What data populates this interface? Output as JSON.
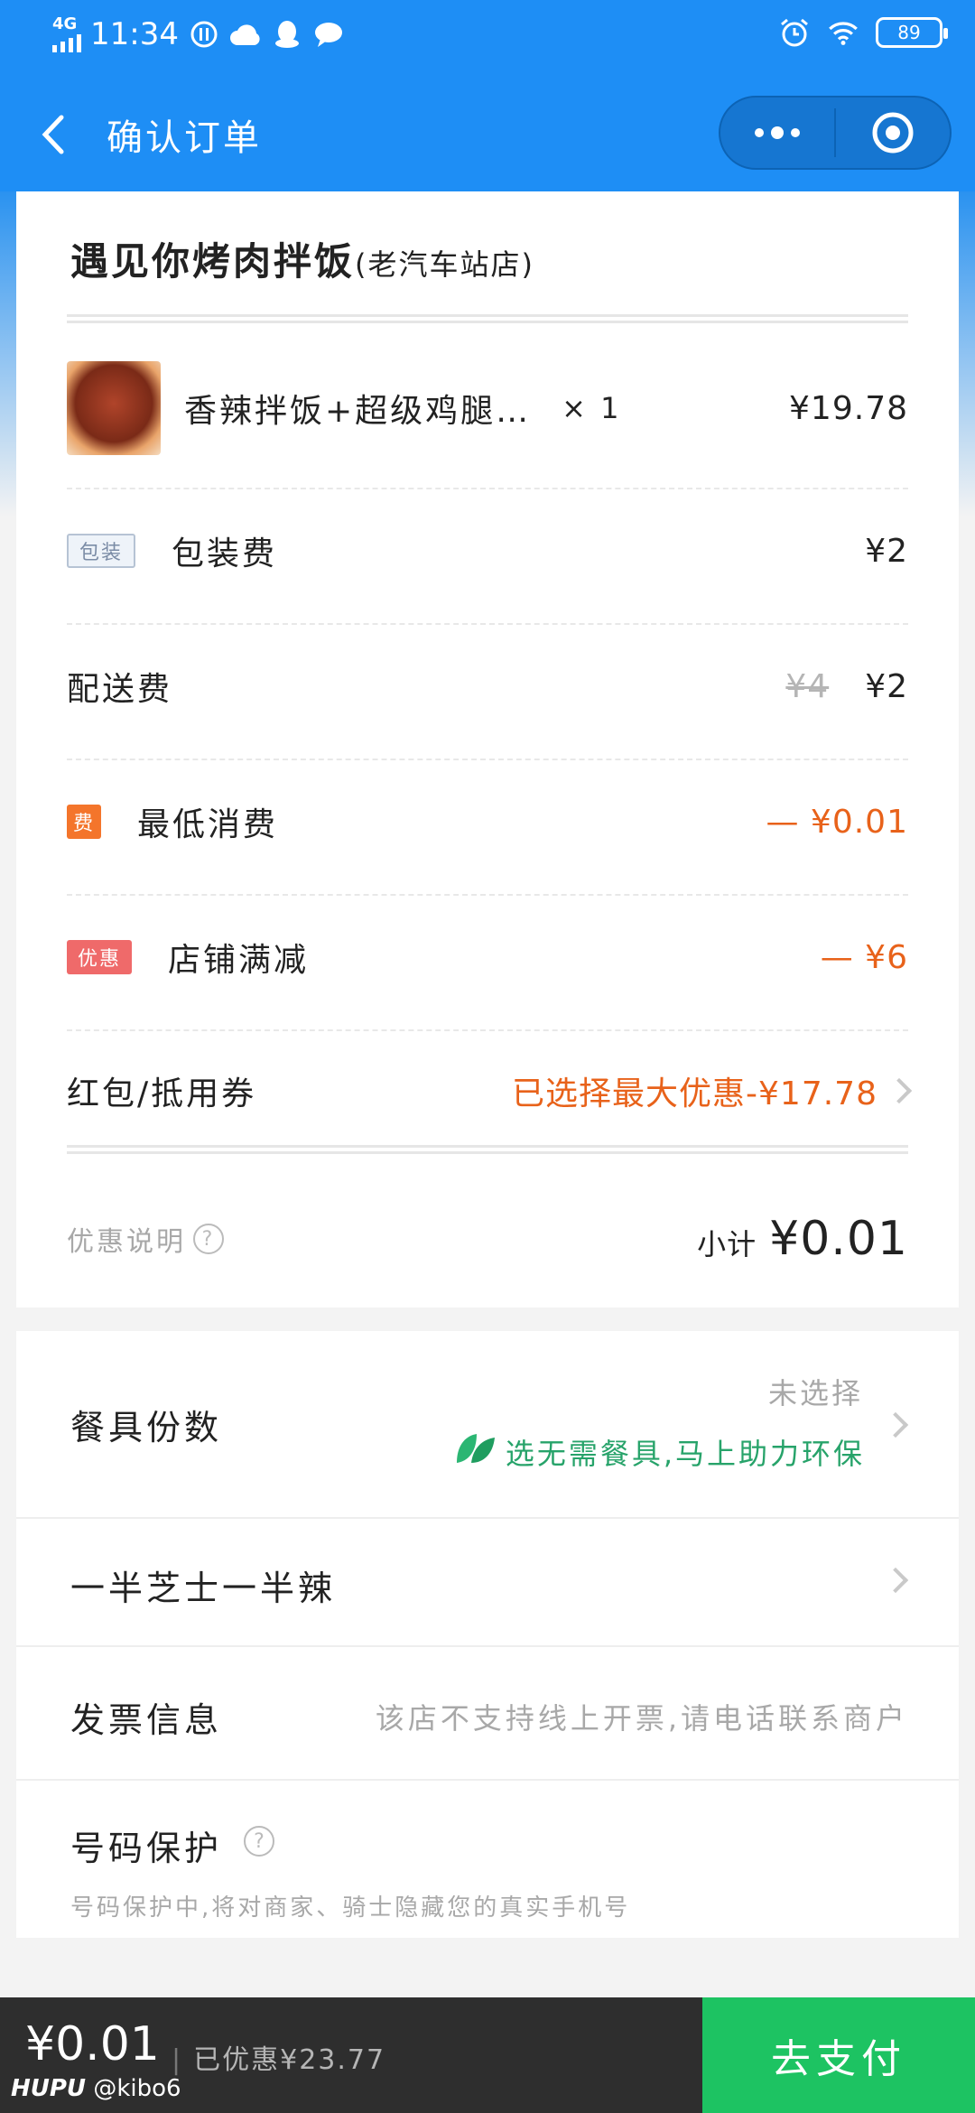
{
  "status_bar": {
    "network": "4G",
    "time": "11:34",
    "battery": "89"
  },
  "nav": {
    "title": "确认订单"
  },
  "shop": {
    "name": "遇见你烤肉拌饭",
    "branch": "(老汽车站店)"
  },
  "order": {
    "item": {
      "name": "香辣拌饭+超级鸡腿…",
      "qty": "× 1",
      "price": "¥19.78"
    },
    "packaging": {
      "tag": "包装",
      "label": "包装费",
      "value": "¥2"
    },
    "delivery": {
      "label": "配送费",
      "original": "¥4",
      "value": "¥2"
    },
    "min_spend": {
      "tag": "费",
      "label": "最低消费",
      "value": "— ¥0.01"
    },
    "discount": {
      "tag": "优惠",
      "label": "店铺满减",
      "value": "— ¥6"
    },
    "coupon": {
      "label": "红包/抵用券",
      "value": "已选择最大优惠-¥17.78"
    },
    "promo_note": "优惠说明",
    "subtotal_label": "小计",
    "subtotal_value": "¥0.01"
  },
  "options": {
    "tableware": {
      "label": "餐具份数",
      "value": "未选择",
      "eco_note": "选无需餐具,马上助力环保"
    },
    "remark": {
      "label": "一半芝士一半辣"
    },
    "invoice": {
      "label": "发票信息",
      "value": "该店不支持线上开票,请电话联系商户"
    },
    "privacy": {
      "label": "号码保护",
      "desc": "号码保护中,将对商家、骑士隐藏您的真实手机号"
    }
  },
  "footer": {
    "total": "¥0.01",
    "saved": "已优惠¥23.77",
    "pay_button": "去支付"
  },
  "watermark": {
    "brand": "HUPU",
    "user": "@kibo6"
  },
  "colors": {
    "primary": "#1e8ef5",
    "accent": "#e8621a",
    "pay": "#1dc362",
    "green": "#27a36a"
  }
}
